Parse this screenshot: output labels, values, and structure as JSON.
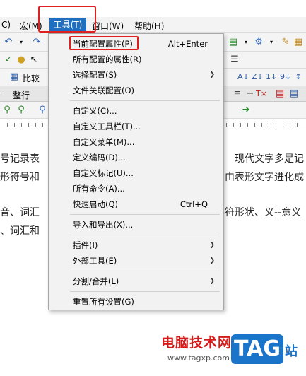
{
  "menubar": {
    "items": [
      {
        "label": "C)"
      },
      {
        "label": "宏(M)"
      },
      {
        "label": "工具(T)"
      },
      {
        "label": "窗口(W)"
      },
      {
        "label": "帮助(H)"
      }
    ]
  },
  "toolbar": {
    "compare_label": "比较"
  },
  "tab": {
    "label": "一整行"
  },
  "document": {
    "lines": [
      "号记录表",
      "现代文字多是记",
      "形符号和",
      "由表形文字进化成",
      "音、词汇",
      "符形状、义--意义",
      "、词汇和"
    ]
  },
  "tools_menu": {
    "items": [
      {
        "label": "当前配置属性(P)",
        "shortcut": "Alt+Enter"
      },
      {
        "label": "所有配置的属性(R)"
      },
      {
        "label": "选择配置(S)"
      },
      {
        "label": "文件关联配置(O)"
      },
      {
        "label": "自定义(C)..."
      },
      {
        "label": "自定义工具栏(T)..."
      },
      {
        "label": "自定义菜单(M)..."
      },
      {
        "label": "定义编码(D)..."
      },
      {
        "label": "自定义标记(U)..."
      },
      {
        "label": "所有命令(A)..."
      },
      {
        "label": "快速启动(Q)",
        "shortcut": "Ctrl+Q"
      },
      {
        "label": "导入和导出(X)..."
      },
      {
        "label": "插件(I)"
      },
      {
        "label": "外部工具(E)"
      },
      {
        "label": "分割/合并(L)"
      },
      {
        "label": "重置所有设置(G)"
      }
    ]
  },
  "watermark": {
    "site_name": "电脑技术网",
    "url": "www.tagxp.com",
    "logo_text": "TAG",
    "suffix": "站"
  },
  "colors": {
    "highlight": "#1f6fc0",
    "annotation_red": "#e02020",
    "watermark_red": "#d51a1a",
    "watermark_blue": "#1a74c9"
  }
}
